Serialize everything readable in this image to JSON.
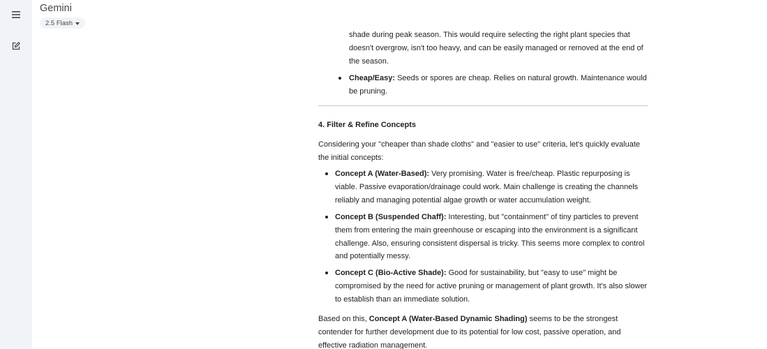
{
  "app": {
    "title": "Gemini",
    "model": "2.5 Flash"
  },
  "rail": {
    "menu_icon": "hamburger-menu-icon",
    "new_chat_icon": "edit-square-icon"
  },
  "response": {
    "continued_paragraph": "shade during peak season. This would require selecting the right plant species that doesn't overgrow, isn't too heavy, and can be easily managed or removed at the end of the season.",
    "cheap_bullet": {
      "label": "Cheap/Easy:",
      "text": " Seeds or spores are cheap. Relies on natural growth. Maintenance would be pruning."
    },
    "section_heading": "4. Filter & Refine Concepts",
    "intro": "Considering your \"cheaper than shade cloths\" and \"easier to use\" criteria, let's quickly evaluate the initial concepts:",
    "concepts": [
      {
        "label": "Concept A (Water-Based):",
        "text": " Very promising. Water is free/cheap. Plastic repurposing is viable. Passive evaporation/drainage could work. Main challenge is creating the channels reliably and managing potential algae growth or water accumulation weight."
      },
      {
        "label": "Concept B (Suspended Chaff):",
        "text": " Interesting, but \"containment\" of tiny particles to prevent them from entering the main greenhouse or escaping into the environment is a significant challenge. Also, ensuring consistent dispersal is tricky. This seems more complex to control and potentially messy."
      },
      {
        "label": "Concept C (Bio-Active Shade):",
        "text": " Good for sustainability, but \"easy to use\" might be compromised by the need for active pruning or management of plant growth. It's also slower to establish than an immediate solution."
      }
    ],
    "conclusion": {
      "before": "Based on this, ",
      "emphasis": "Concept A (Water-Based Dynamic Shading)",
      "after": " seems to be the strongest contender for further development due to its potential for low cost, passive operation, and effective radiation management."
    }
  },
  "colors": {
    "rail_background": "#f0f4f9",
    "text": "#1f1f1f",
    "muted_text": "#444746",
    "divider": "#c4c7c5"
  }
}
